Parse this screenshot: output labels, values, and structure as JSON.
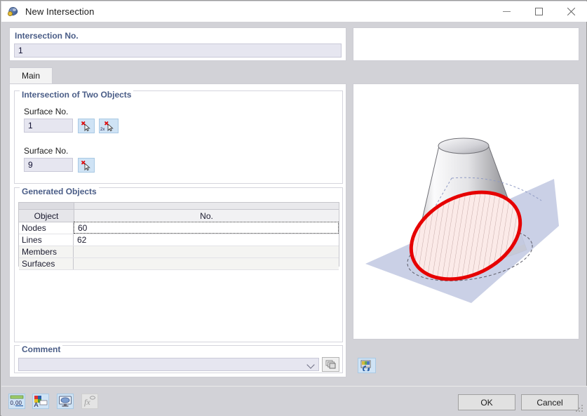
{
  "window": {
    "title": "New Intersection",
    "icon": "intersection-icon",
    "controls": {
      "minimize": "minimize-icon",
      "maximize": "maximize-icon",
      "close": "close-icon"
    }
  },
  "top": {
    "intersection_no_label": "Intersection No.",
    "intersection_no_value": "1"
  },
  "tabs": [
    {
      "label": "Main",
      "selected": true
    }
  ],
  "two_objects": {
    "title": "Intersection of Two Objects",
    "surface1_label": "Surface No.",
    "surface1_value": "1",
    "surface1_pick": "pick-single-icon",
    "surface1_pick2": "pick-multiple-icon",
    "surface2_label": "Surface No.",
    "surface2_value": "9",
    "surface2_pick": "pick-single-icon"
  },
  "generated": {
    "title": "Generated Objects",
    "columns": [
      "Object",
      "No."
    ],
    "rows": [
      {
        "object": "Nodes",
        "no": "60"
      },
      {
        "object": "Lines",
        "no": "62"
      },
      {
        "object": "Members",
        "no": ""
      },
      {
        "object": "Surfaces",
        "no": ""
      }
    ]
  },
  "comment": {
    "title": "Comment",
    "value": "",
    "placeholder": "",
    "dropdown": "chevron-down-icon",
    "copy_button": "copy-comment-icon",
    "image_button": "refresh-image-icon"
  },
  "footer": {
    "tools": [
      {
        "name": "decimal-places-icon",
        "label": "0,00",
        "disabled": false
      },
      {
        "name": "font-color-icon",
        "label": "",
        "disabled": false
      },
      {
        "name": "display-properties-icon",
        "label": "",
        "disabled": false
      },
      {
        "name": "formula-icon",
        "label": "fx",
        "disabled": true
      }
    ],
    "ok": "OK",
    "cancel": "Cancel",
    "grip": "resize-grip"
  },
  "graphic": {
    "name": "cone-plane-intersection-preview",
    "colors": {
      "plane": "#c5cce4",
      "ellipse_stroke": "#e60000",
      "ellipse_fill": "#fbeae8",
      "cone_light": "#fdfdfd",
      "cone_dark": "#9a9a9e"
    }
  }
}
